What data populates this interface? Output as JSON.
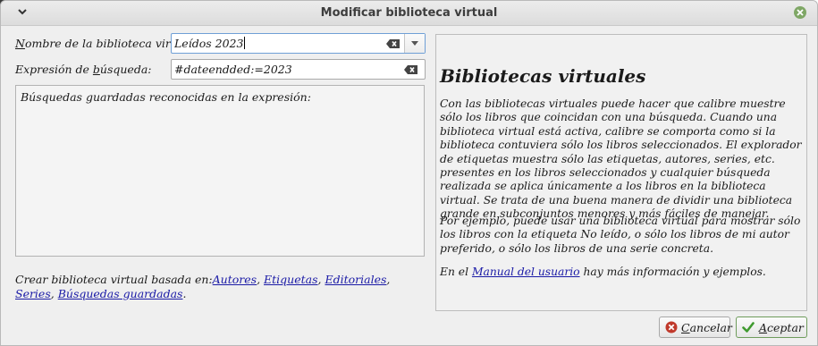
{
  "window": {
    "title": "Modificar biblioteca virtual"
  },
  "form": {
    "name_label_prefix": "N",
    "name_label_rest": "ombre de la biblioteca virtual:",
    "name_value": "Leídos 2023",
    "search_label_prefix": "Expresión de ",
    "search_label_u": "b",
    "search_label_rest": "úsqueda:",
    "search_value": "#dateendded:=2023"
  },
  "saved_searches": {
    "label": "Búsquedas guardadas reconocidas en la expresión:"
  },
  "create": {
    "prefix": "Crear biblioteca virtual basada en:",
    "links": [
      "Autores",
      "Etiquetas",
      "Editoriales",
      "Series",
      "Búsquedas guardadas"
    ],
    "separator": ", ",
    "end": "."
  },
  "help": {
    "title": "Bibliotecas virtuales",
    "p1": "Con las bibliotecas virtuales puede hacer que calibre muestre sólo los libros que coincidan con una búsqueda. Cuando una biblioteca virtual está activa, calibre se comporta como si la biblioteca contuviera sólo los libros seleccionados. El explorador de etiquetas muestra sólo las etiquetas, autores, series, etc. presentes en los libros seleccionados y cualquier búsqueda realizada se aplica únicamente a los libros en la biblioteca virtual. Se trata de una buena manera de dividir una biblioteca grande en subconjuntos menores y más fáciles de manejar.",
    "p2": "Por ejemplo, puede usar una biblioteca virtual para mostrar sólo los libros con la etiqueta No leído, o sólo los libros de mi autor preferido, o sólo los libros de una serie concreta.",
    "p3_prefix": "En el ",
    "p3_link": "Manual del usuario",
    "p3_suffix": " hay más información y ejemplos."
  },
  "buttons": {
    "cancel_u": "C",
    "cancel_rest": "ancelar",
    "ok_u": "A",
    "ok_rest": "ceptar"
  },
  "colors": {
    "link": "#1a1aa6",
    "ok_check": "#3f9a2f",
    "cancel_icon": "#c0392b",
    "close": "#7fa766"
  }
}
